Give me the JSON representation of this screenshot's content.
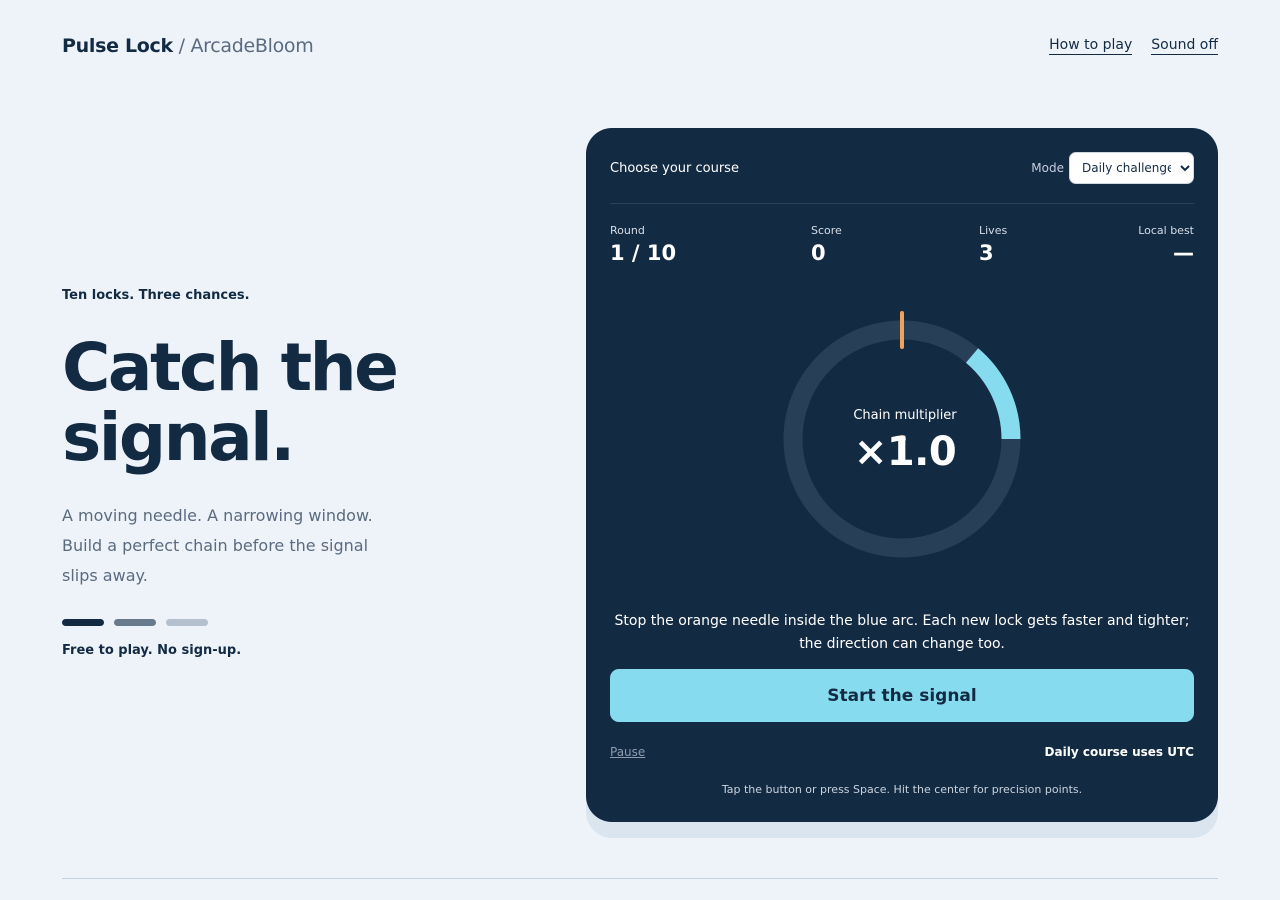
{
  "header": {
    "brand_name": "Pulse Lock",
    "brand_separator": "/",
    "brand_studio": "ArcadeBloom",
    "links": [
      "How to play",
      "Sound off"
    ]
  },
  "hero": {
    "eyebrow": "Ten locks. Three chances.",
    "headline": "Catch the signal.",
    "subtitle": "A moving needle. A narrowing window. Build a perfect chain before the signal slips away.",
    "progress_steps": 3,
    "footnote": "Free to play. No sign-up."
  },
  "game": {
    "title": "Choose your course",
    "mode_label": "Mode",
    "mode_selected": "Daily challenge",
    "stats": [
      {
        "label": "Round",
        "value": "1 / 10"
      },
      {
        "label": "Score",
        "value": "0"
      },
      {
        "label": "Lives",
        "value": "3"
      },
      {
        "label": "Local best",
        "value": "—"
      }
    ],
    "dial": {
      "label": "Chain multiplier",
      "value": "×1.0",
      "target_arc_start_deg": 40,
      "target_arc_end_deg": 90,
      "needle_angle_deg": 0,
      "colors": {
        "track": "#283f58",
        "target": "#86dcee",
        "needle": "#f2a05a"
      }
    },
    "instructions": "Stop the orange needle inside the blue arc. Each new lock gets faster and tighter; the direction can change too.",
    "start_label": "Start the signal",
    "pause_label": "Pause",
    "utc_note": "Daily course uses UTC",
    "hint": "Tap the button or press Space. Hit the center for precision points."
  },
  "colors": {
    "page_bg": "#eef3fa",
    "card_bg": "#132a43",
    "accent": "#86dcee",
    "needle": "#f2a05a"
  }
}
